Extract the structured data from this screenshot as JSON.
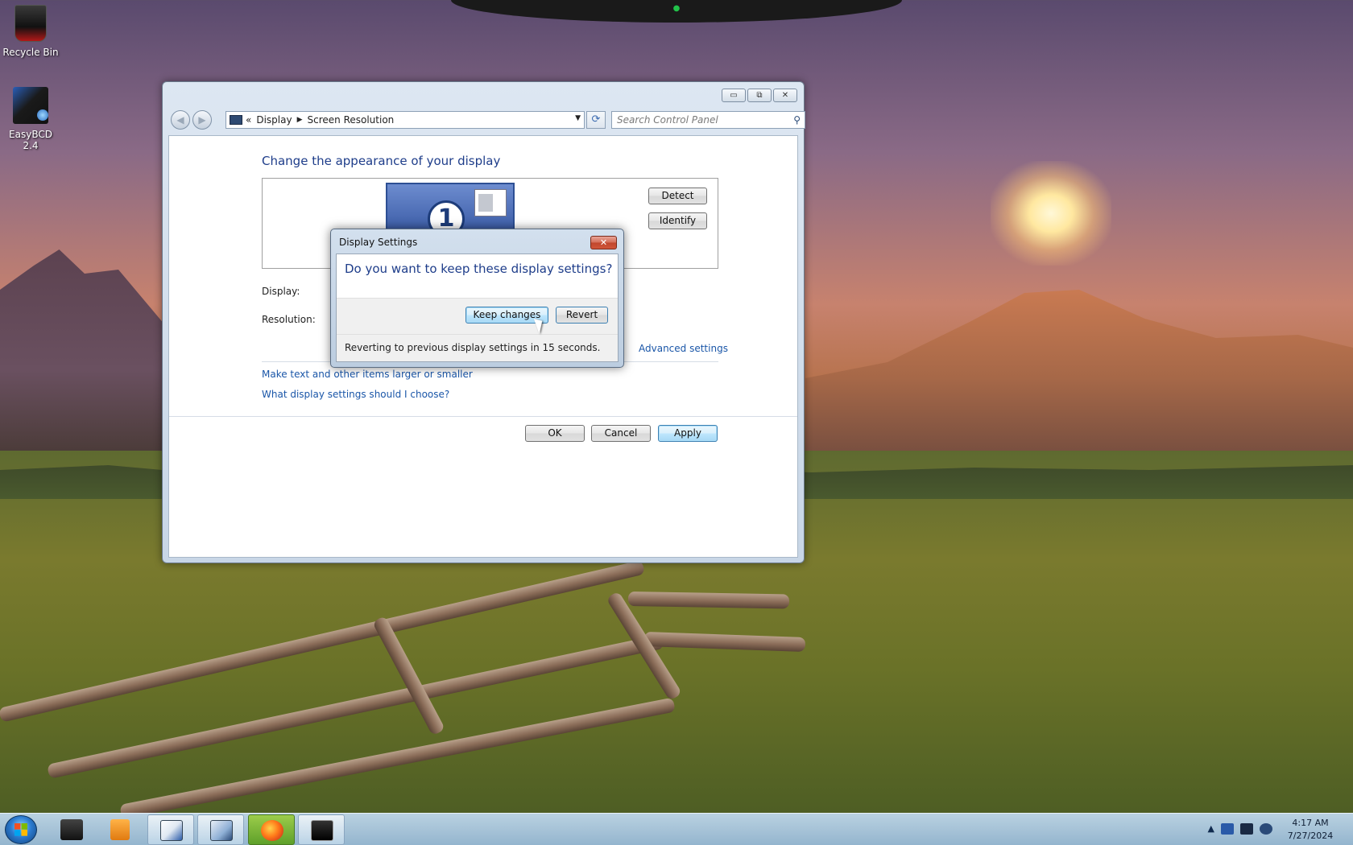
{
  "desktop": {
    "icons": [
      {
        "label": "Recycle Bin"
      },
      {
        "label": "EasyBCD 2.4"
      }
    ]
  },
  "window": {
    "address": {
      "crumb_prefix": "«",
      "crumbs": [
        "Display",
        "Screen Resolution"
      ]
    },
    "search": {
      "placeholder": "Search Control Panel"
    },
    "controls": {
      "minimize": "▭",
      "maximize": "⧉",
      "close": "✕"
    },
    "content": {
      "title": "Change the appearance of your display",
      "monitor_number": "1",
      "detect_label": "Detect",
      "identify_label": "Identify",
      "display_label": "Display:",
      "resolution_label": "Resolution:",
      "advanced_link": "Advanced settings",
      "links": [
        "Make text and other items larger or smaller",
        "What display settings should I choose?"
      ],
      "ok_label": "OK",
      "cancel_label": "Cancel",
      "apply_label": "Apply"
    }
  },
  "dialog": {
    "title": "Display Settings",
    "close_label": "✕",
    "question": "Do you want to keep these display settings?",
    "keep_label": "Keep changes",
    "revert_label": "Revert",
    "countdown_text": "Reverting to previous display settings in 15 seconds."
  },
  "taskbar": {
    "clock_time": "4:17 AM",
    "clock_date": "7/27/2024",
    "tray_arrow": "▲"
  }
}
